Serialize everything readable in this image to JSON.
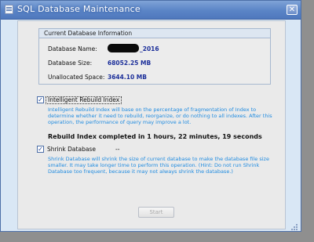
{
  "window": {
    "title": "SQL Database Maintenance",
    "close_glyph": "✕",
    "icon": "document-icon"
  },
  "database_info": {
    "group_title": "Current Database Information",
    "name_label": "Database Name:",
    "name_value_suffix": "_2016",
    "size_label": "Database Size:",
    "size_value": "68052.25 MB",
    "unallocated_label": "Unallocated Space:",
    "unallocated_value": "3644.10 MB"
  },
  "rebuild": {
    "checked": true,
    "label": "Intelligent Rebuild Index",
    "description": "Intelligent Rebuild Index will base on the percentage of fragmentation of Index to determine whether it need to rebuild, reorganize, or do nothing to all indexes. After this operation, the performance of query may improve a lot.",
    "status": "Rebuild Index completed in 1 hours, 22 minutes, 19 seconds"
  },
  "shrink": {
    "checked": true,
    "label": "Shrink Database",
    "status": "--",
    "description": "Shrink Database will shrink the size of current database to make the database file size smaller. It may take longer time to perform this operation. (Hint: Do not run Shrink Database too frequent, because it may not always shrink the database.)"
  },
  "start_button": {
    "label": "Start",
    "enabled": false
  },
  "colors": {
    "title_bar": "#5a84c6",
    "value_text": "#1c2f9a",
    "description_text": "#1f8be0",
    "window_frame": "#d9e7f5"
  }
}
